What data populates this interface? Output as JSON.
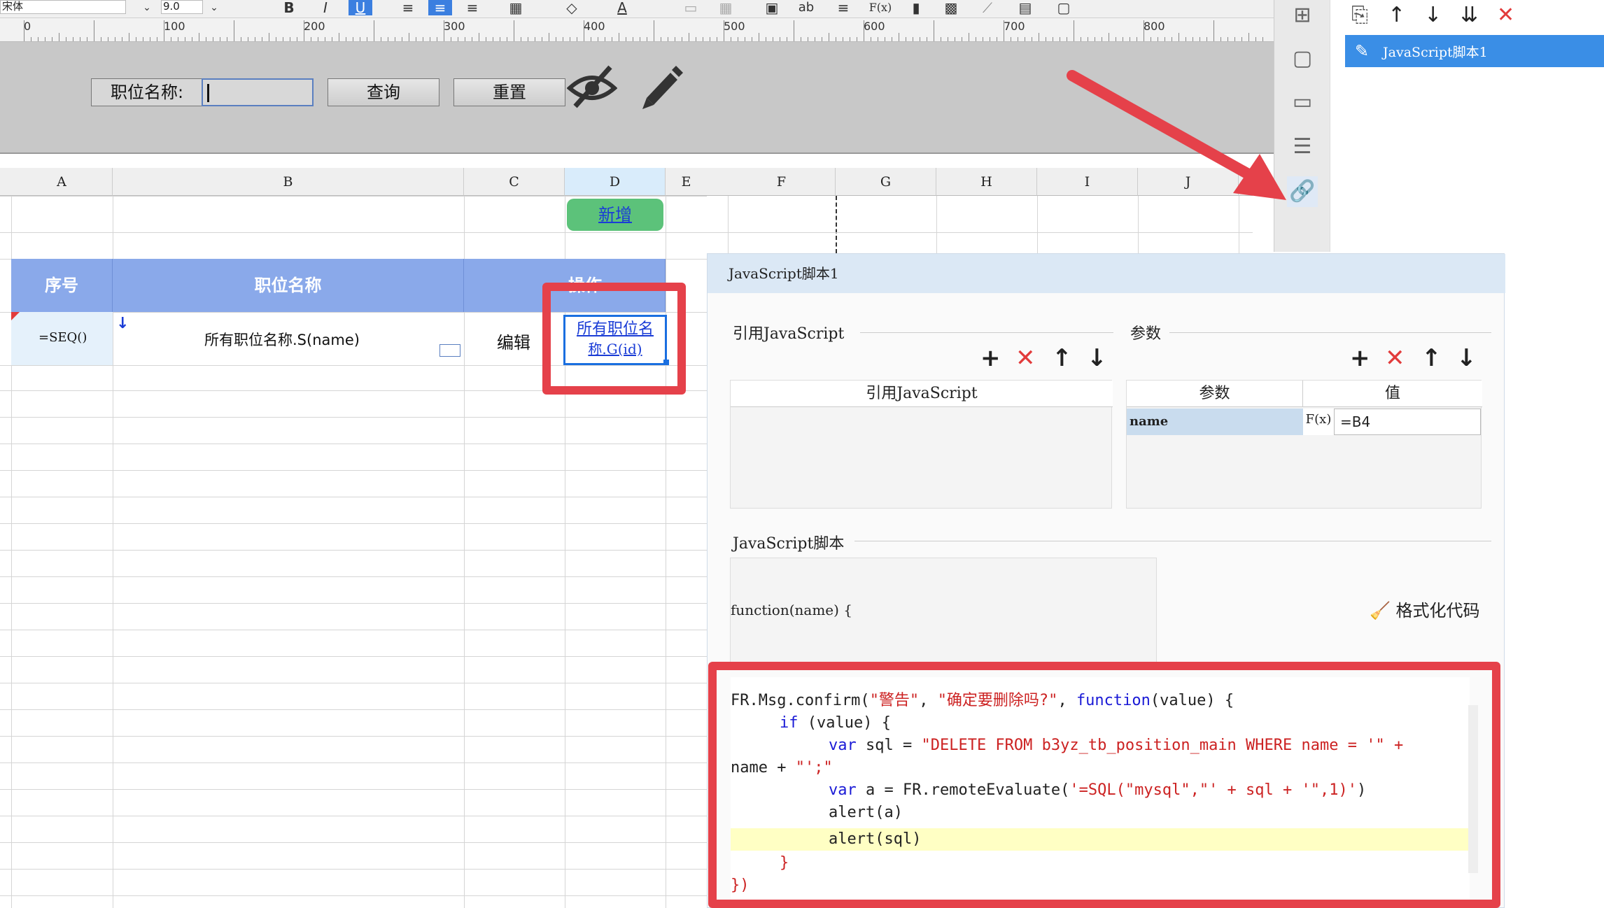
{
  "toolbar": {
    "font_name": "宋体",
    "font_size": "9.0",
    "bold": "B",
    "italic": "I",
    "underline": "U",
    "formula": "F(x)",
    "ab": "ab"
  },
  "ruler": {
    "ticks": [
      "0",
      "100",
      "200",
      "300",
      "400",
      "500",
      "600",
      "700",
      "800"
    ]
  },
  "param_panel": {
    "label": "职位名称:",
    "input_value": "",
    "query_button": "查询",
    "reset_button": "重置"
  },
  "grid": {
    "columns": [
      "A",
      "B",
      "C",
      "D",
      "E",
      "F",
      "G",
      "H",
      "I",
      "J"
    ],
    "add_link": "新增",
    "header_seq": "序号",
    "header_name": "职位名称",
    "header_op": "操作",
    "row_seq": "=SEQ()",
    "row_name": "所有职位名称.S(name)",
    "row_edit": "编辑",
    "row_delete_line1": "所有职位名",
    "row_delete_line2": "称.G(id)"
  },
  "right_panel": {
    "item_label": "JavaScript脚本1"
  },
  "dialog": {
    "title": "JavaScript脚本1",
    "ref_section": "引用JavaScript",
    "ref_column": "引用JavaScript",
    "param_section": "参数",
    "param_col_name": "参数",
    "param_col_value": "值",
    "param_row_name": "name",
    "param_row_fx": "F(x)",
    "param_row_value": "=B4",
    "script_section": "JavaScript脚本",
    "function_sig": "function(name) {",
    "format_code": "格式化代码"
  },
  "code": {
    "l1a": "FR.Msg.confirm(",
    "l1b": "\"警告\"",
    "l1c": ", ",
    "l1d": "\"确定要删除吗?\"",
    "l1e": ", ",
    "l1f": "function",
    "l1g": "(value) {",
    "l2a": "if",
    "l2b": " (value) {",
    "l3a": "var",
    "l3b": " sql = ",
    "l3c": "\"DELETE FROM b3yz_tb_position_main WHERE name = '\" +",
    "l4a": "name + ",
    "l4b": "\"';\"",
    "l5a": "var",
    "l5b": " a = FR.remoteEvaluate(",
    "l5c": "'=SQL(\"mysql\",\"' + sql + '\",1)'",
    "l5d": ")",
    "l6": "alert(a)",
    "l7": "alert(sql)",
    "l8": "}",
    "l9": "})"
  },
  "colors": {
    "highlight": "#e5414a",
    "selected": "#3a8ee6",
    "header_blue": "#8aa9ea",
    "add_button": "#5cc27a"
  }
}
